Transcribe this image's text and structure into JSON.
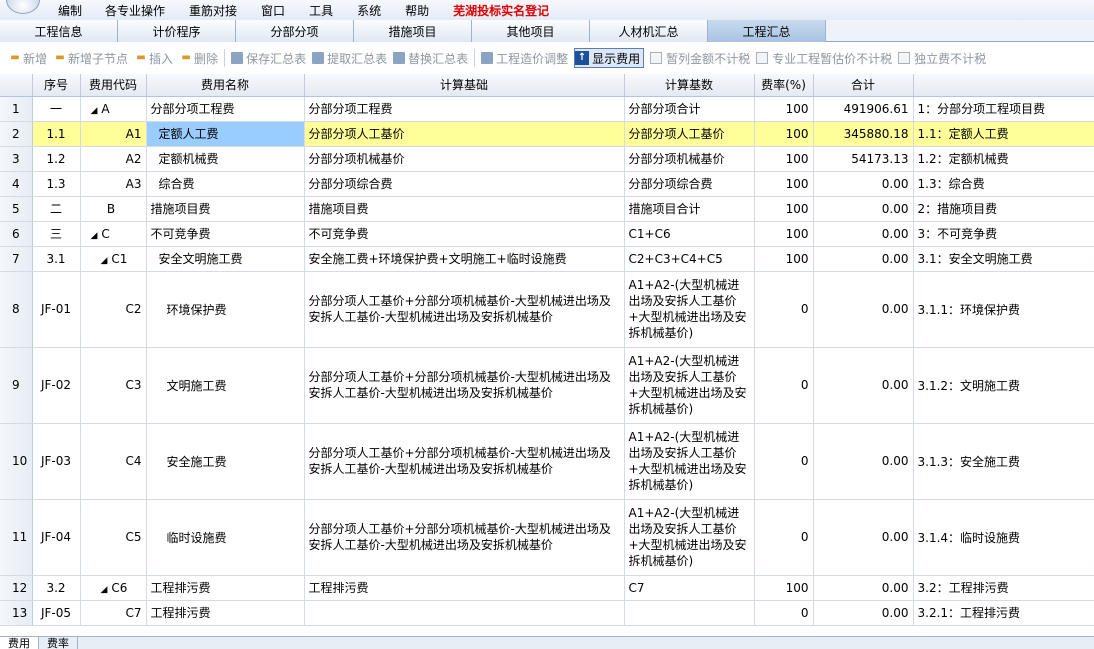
{
  "menu": {
    "items": [
      "编制",
      "各专业操作",
      "重筋对接",
      "窗口",
      "工具",
      "系统",
      "帮助"
    ],
    "highlight": "芜湖投标实名登记"
  },
  "tabs": [
    {
      "label": "工程信息",
      "active": false
    },
    {
      "label": "计价程序",
      "active": false
    },
    {
      "label": "分部分项",
      "active": false
    },
    {
      "label": "措施项目",
      "active": false
    },
    {
      "label": "其他项目",
      "active": false
    },
    {
      "label": "人材机汇总",
      "active": false
    },
    {
      "label": "工程汇总",
      "active": true
    }
  ],
  "toolbar": {
    "add": "新增",
    "add_child": "新增子节点",
    "insert": "插入",
    "delete": "删除",
    "save_summary": "保存汇总表",
    "extract_summary": "提取汇总表",
    "replace_summary": "替换汇总表",
    "cost_adjust": "工程造价调整",
    "show_fee": "显示费用",
    "chk_tentative": "暂列金额不计税",
    "chk_provisional": "专业工程暂估价不计税",
    "chk_independent": "独立费不计税"
  },
  "table": {
    "headers": [
      "",
      "序号",
      "费用代码",
      "费用名称",
      "计算基础",
      "计算基数",
      "费率(%)",
      "合计",
      ""
    ],
    "rows": [
      {
        "no": "1",
        "seq": "一",
        "code": "A",
        "expander": "◢",
        "name": "分部分项工程费",
        "basis": "分部分项工程费",
        "base": "分部分项合计",
        "rate": "100",
        "total": "491906.61",
        "desc": "1：分部分项工程项目费"
      },
      {
        "no": "2",
        "seq": "1.1",
        "code": "A1",
        "expander": "",
        "name": "定额人工费",
        "basis": "分部分项人工基价",
        "base": "分部分项人工基价",
        "rate": "100",
        "total": "345880.18",
        "desc": "1.1：定额人工费"
      },
      {
        "no": "3",
        "seq": "1.2",
        "code": "A2",
        "expander": "",
        "name": "定额机械费",
        "basis": "分部分项机械基价",
        "base": "分部分项机械基价",
        "rate": "100",
        "total": "54173.13",
        "desc": "1.2：定额机械费"
      },
      {
        "no": "4",
        "seq": "1.3",
        "code": "A3",
        "expander": "",
        "name": "综合费",
        "basis": "分部分项综合费",
        "base": "分部分项综合费",
        "rate": "100",
        "total": "0.00",
        "desc": "1.3：综合费"
      },
      {
        "no": "5",
        "seq": "二",
        "code": "B",
        "expander": "",
        "name": "措施项目费",
        "basis": "措施项目费",
        "base": "措施项目合计",
        "rate": "100",
        "total": "0.00",
        "desc": "2：措施项目费"
      },
      {
        "no": "6",
        "seq": "三",
        "code": "C",
        "expander": "◢",
        "name": "不可竞争费",
        "basis": "不可竞争费",
        "base": "C1+C6",
        "rate": "100",
        "total": "0.00",
        "desc": "3：不可竞争费"
      },
      {
        "no": "7",
        "seq": "3.1",
        "code": "C1",
        "expander": "◢",
        "name": "安全文明施工费",
        "basis": "安全施工费+环境保护费+文明施工+临时设施费",
        "base": "C2+C3+C4+C5",
        "rate": "100",
        "total": "0.00",
        "desc": "3.1：安全文明施工费"
      },
      {
        "no": "8",
        "seq": "JF-01",
        "code": "C2",
        "expander": "",
        "name": "环境保护费",
        "basis": "分部分项人工基价+分部分项机械基价-大型机械进出场及安拆人工基价-大型机械进出场及安拆机械基价",
        "base": "A1+A2-(大型机械进出场及安拆人工基价+大型机械进出场及安拆机械基价)",
        "rate": "0",
        "total": "0.00",
        "desc": "3.1.1：环境保护费"
      },
      {
        "no": "9",
        "seq": "JF-02",
        "code": "C3",
        "expander": "",
        "name": "文明施工费",
        "basis": "分部分项人工基价+分部分项机械基价-大型机械进出场及安拆人工基价-大型机械进出场及安拆机械基价",
        "base": "A1+A2-(大型机械进出场及安拆人工基价+大型机械进出场及安拆机械基价)",
        "rate": "0",
        "total": "0.00",
        "desc": "3.1.2：文明施工费"
      },
      {
        "no": "10",
        "seq": "JF-03",
        "code": "C4",
        "expander": "",
        "name": "安全施工费",
        "basis": "分部分项人工基价+分部分项机械基价-大型机械进出场及安拆人工基价-大型机械进出场及安拆机械基价",
        "base": "A1+A2-(大型机械进出场及安拆人工基价+大型机械进出场及安拆机械基价)",
        "rate": "0",
        "total": "0.00",
        "desc": "3.1.3：安全施工费"
      },
      {
        "no": "11",
        "seq": "JF-04",
        "code": "C5",
        "expander": "",
        "name": "临时设施费",
        "basis": "分部分项人工基价+分部分项机械基价-大型机械进出场及安拆人工基价-大型机械进出场及安拆机械基价",
        "base": "A1+A2-(大型机械进出场及安拆人工基价+大型机械进出场及安拆机械基价)",
        "rate": "0",
        "total": "0.00",
        "desc": "3.1.4：临时设施费"
      },
      {
        "no": "12",
        "seq": "3.2",
        "code": "C6",
        "expander": "◢",
        "name": "工程排污费",
        "basis": "工程排污费",
        "base": "C7",
        "rate": "100",
        "total": "0.00",
        "desc": "3.2：工程排污费"
      },
      {
        "no": "13",
        "seq": "JF-05",
        "code": "C7",
        "expander": "",
        "name": "工程排污费",
        "basis": "",
        "base": "",
        "rate": "0",
        "total": "0.00",
        "desc": "3.2.1：工程排污费"
      }
    ]
  },
  "bottom_tabs": [
    "费用",
    "费率"
  ],
  "colors": {
    "selected_row": "#ffff99",
    "focus_cell": "#99ccff",
    "highlight_menu": "#e00000"
  }
}
